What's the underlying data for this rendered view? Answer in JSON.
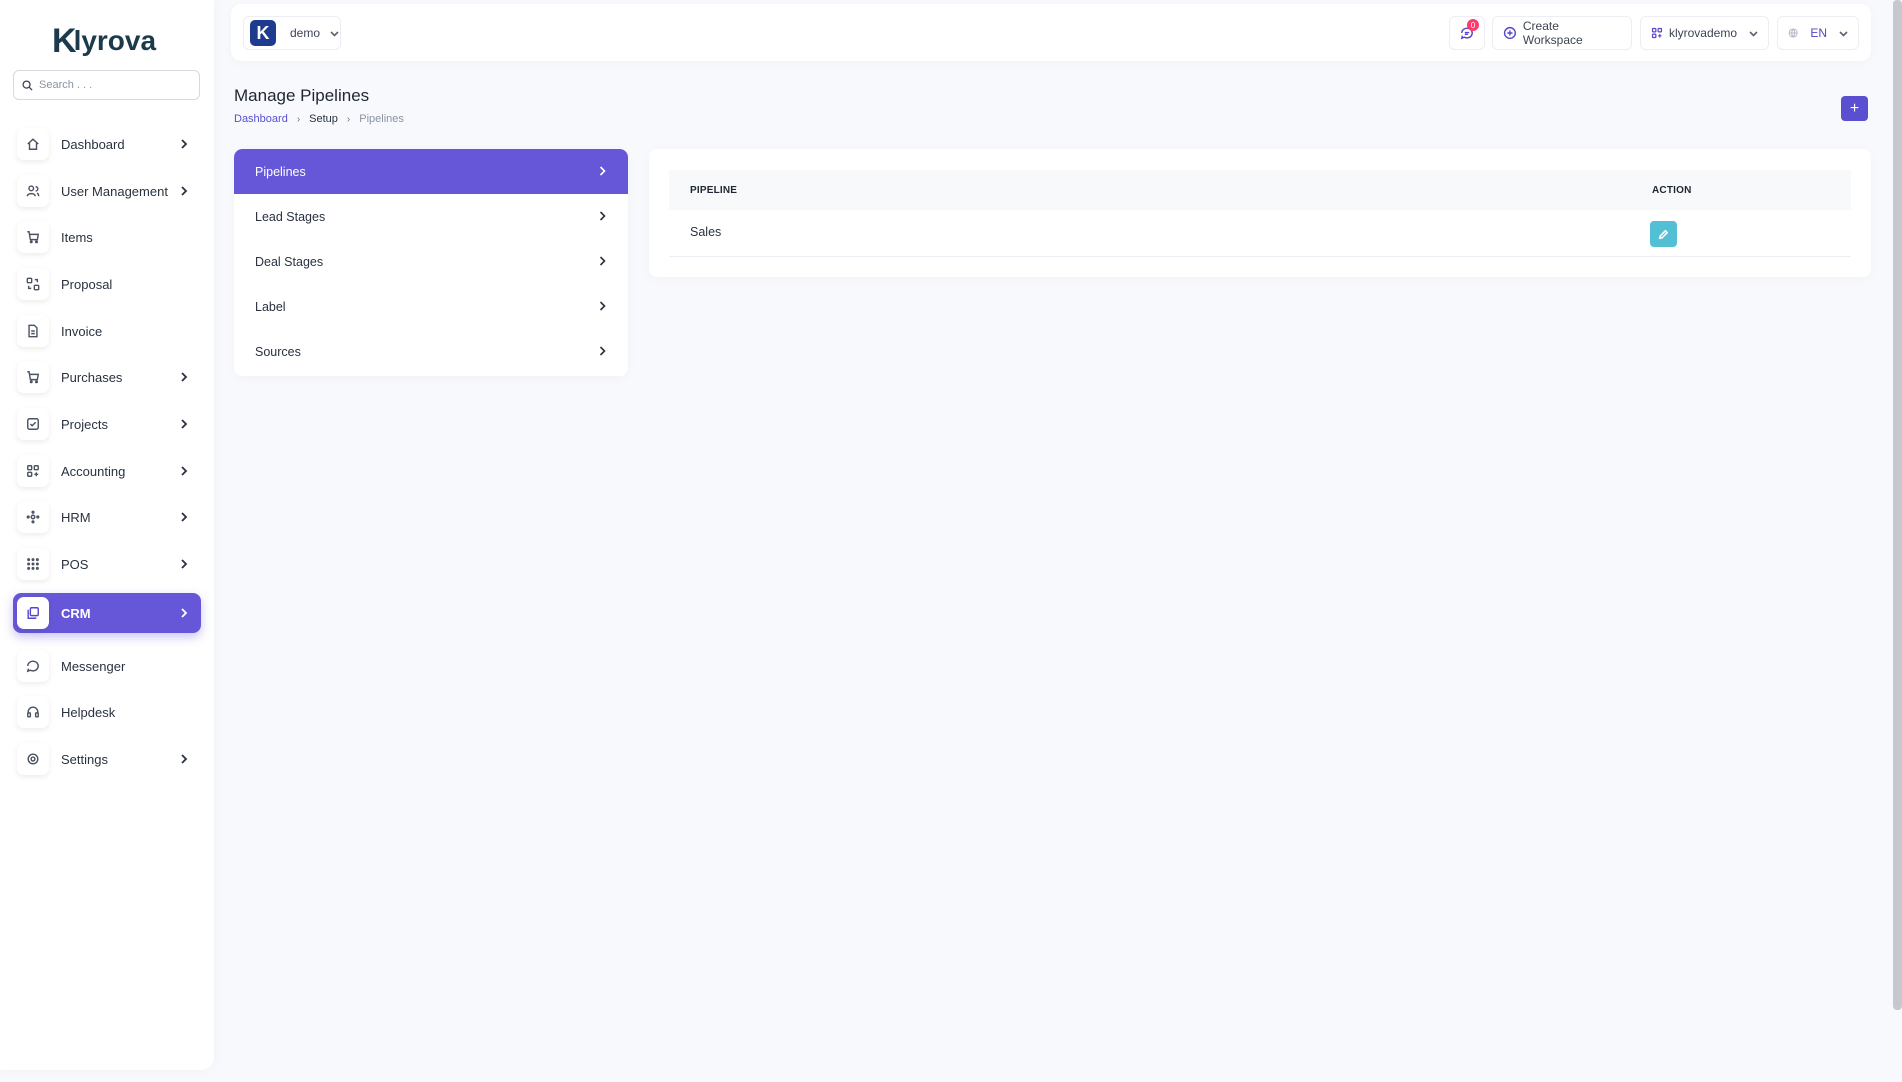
{
  "brand": {
    "logo_mark": "K",
    "logo_text": "lyrova"
  },
  "search": {
    "placeholder": "Search . . ."
  },
  "sidebar": {
    "items": [
      {
        "label": "Dashboard",
        "icon": "home-icon",
        "has_chevron": true
      },
      {
        "label": "User Management",
        "icon": "users-icon",
        "has_chevron": true
      },
      {
        "label": "Items",
        "icon": "cart-icon",
        "has_chevron": false
      },
      {
        "label": "Proposal",
        "icon": "swap-icon",
        "has_chevron": false
      },
      {
        "label": "Invoice",
        "icon": "file-icon",
        "has_chevron": false
      },
      {
        "label": "Purchases",
        "icon": "cart-icon",
        "has_chevron": true
      },
      {
        "label": "Projects",
        "icon": "checkbox-icon",
        "has_chevron": true
      },
      {
        "label": "Accounting",
        "icon": "apps-icon",
        "has_chevron": true
      },
      {
        "label": "HRM",
        "icon": "network-icon",
        "has_chevron": true
      },
      {
        "label": "POS",
        "icon": "grid-dots-icon",
        "has_chevron": true
      },
      {
        "label": "CRM",
        "icon": "layers-icon",
        "has_chevron": true,
        "active": true
      },
      {
        "label": "Messenger",
        "icon": "message-icon",
        "has_chevron": false
      },
      {
        "label": "Helpdesk",
        "icon": "headset-icon",
        "has_chevron": false
      },
      {
        "label": "Settings",
        "icon": "gear-icon",
        "has_chevron": true
      }
    ]
  },
  "header": {
    "workspace": {
      "avatar_letter": "K",
      "name": "demo"
    },
    "notifications": {
      "count": "0"
    },
    "create_workspace": "Create Workspace",
    "user": "klyrovademo",
    "language": "EN"
  },
  "page": {
    "title": "Manage Pipelines",
    "breadcrumb": [
      "Dashboard",
      "Setup",
      "Pipelines"
    ]
  },
  "setup_menu": {
    "items": [
      {
        "label": "Pipelines",
        "active": true
      },
      {
        "label": "Lead Stages"
      },
      {
        "label": "Deal Stages"
      },
      {
        "label": "Label"
      },
      {
        "label": "Sources"
      }
    ]
  },
  "table": {
    "columns": [
      "PIPELINE",
      "ACTION"
    ],
    "rows": [
      {
        "pipeline": "Sales"
      }
    ]
  },
  "colors": {
    "accent": "#6657d8",
    "edit_button": "#52bfd4",
    "badge": "#ff3a6e"
  }
}
